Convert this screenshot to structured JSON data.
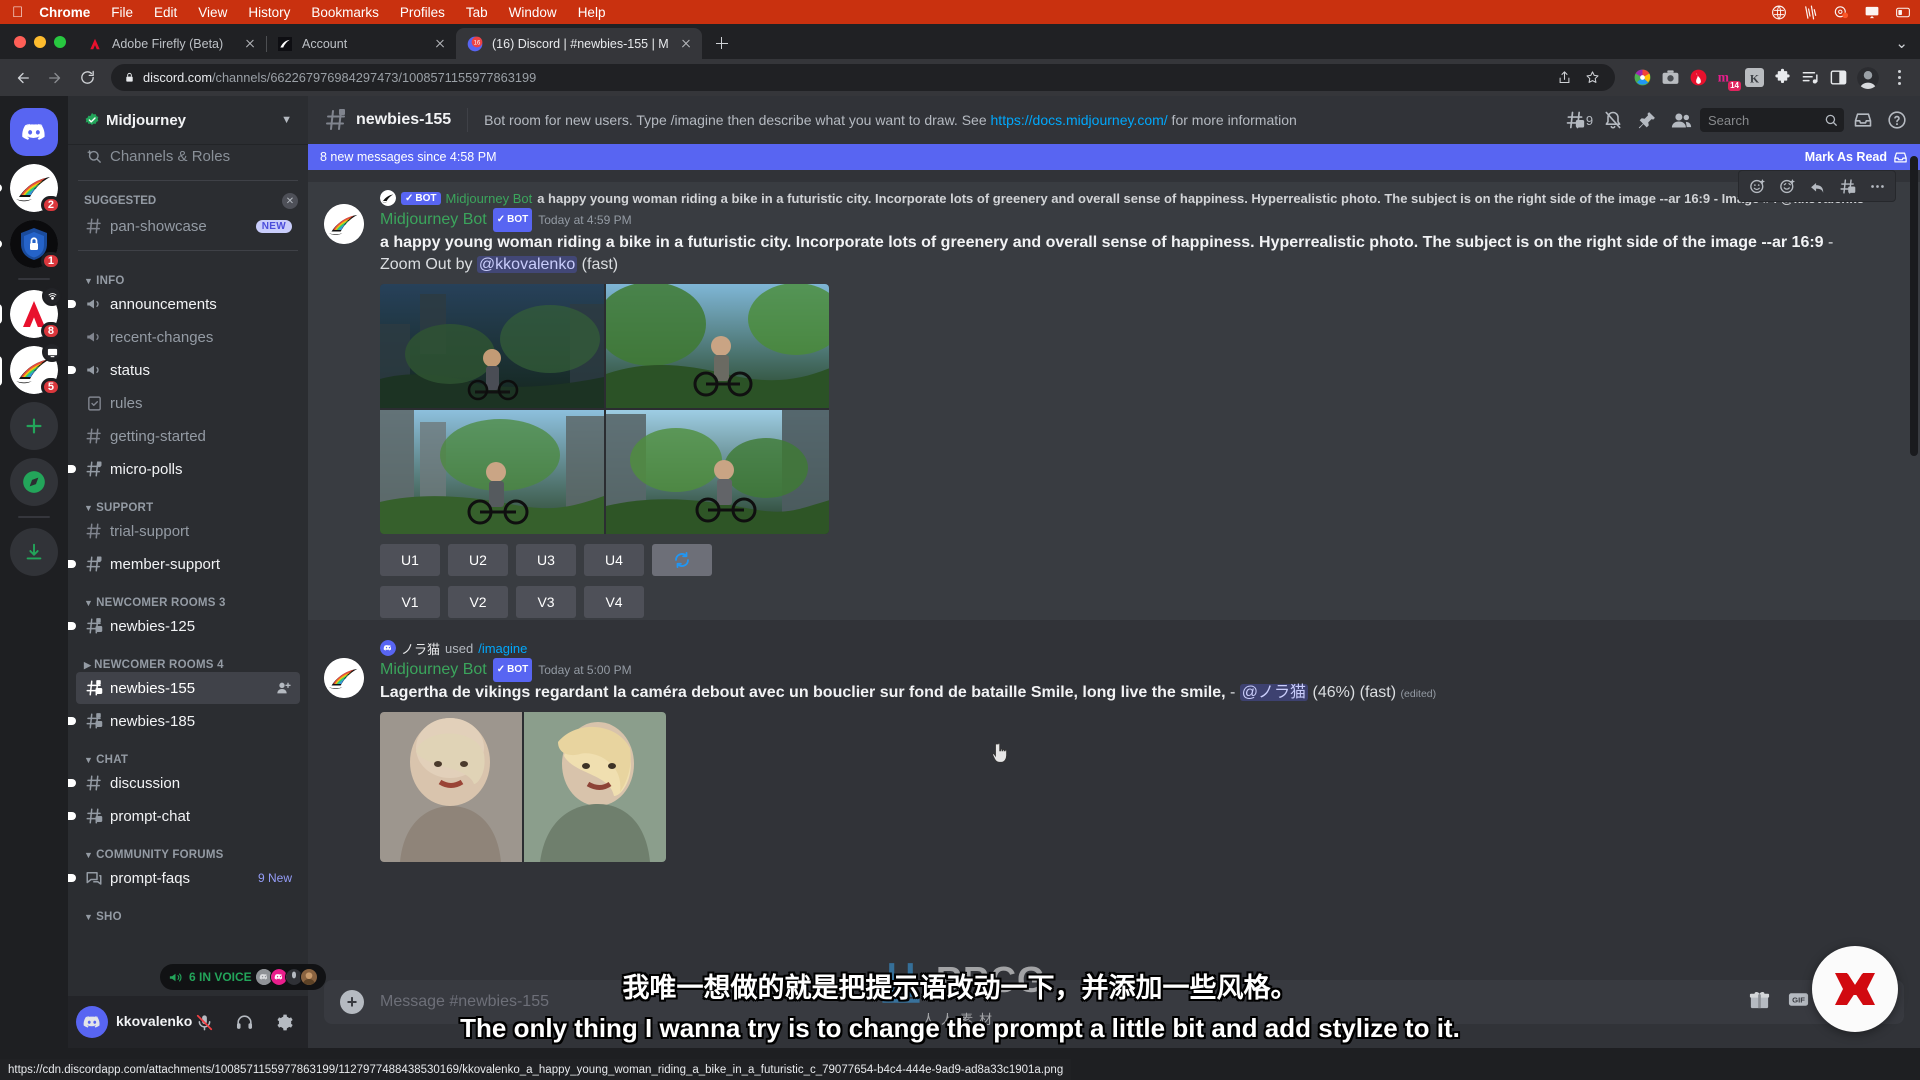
{
  "menubar": {
    "apple": "",
    "items": [
      "Chrome",
      "File",
      "Edit",
      "View",
      "History",
      "Bookmarks",
      "Profiles",
      "Tab",
      "Window",
      "Help"
    ],
    "status_icons": [
      "globe-icon",
      "waveform-icon",
      "color-wheel-icon",
      "airplay-display-icon",
      "control-center-icon"
    ]
  },
  "browser": {
    "tabs": [
      {
        "title": "Adobe Firefly (Beta)",
        "favicon": "adobe-icon",
        "active": false
      },
      {
        "title": "Account",
        "favicon": "midjourney-icon",
        "active": false
      },
      {
        "title": "(16) Discord | #newbies-155 | M",
        "favicon": "discord-badge-16",
        "active": true
      }
    ],
    "new_tab_label": "+",
    "nav": {
      "back": "←",
      "forward": "→",
      "reload": "↻"
    },
    "address": {
      "lock": "lock-icon",
      "host": "discord.com",
      "path": "/channels/662267976984297473/1008571155977863199"
    },
    "omni_actions": [
      "share-icon",
      "bookmark-star-icon"
    ],
    "extensions": [
      {
        "name": "color-palette-extension",
        "badge": ""
      },
      {
        "name": "screenshot-camera-extension",
        "badge": ""
      },
      {
        "name": "record-red-extension",
        "badge": ""
      },
      {
        "name": "mm-pink-extension",
        "badge": "14"
      },
      {
        "name": "gray-k-extension",
        "badge": ""
      },
      {
        "name": "puzzle-extensions-icon",
        "badge": ""
      },
      {
        "name": "playlist-music-icon",
        "badge": ""
      },
      {
        "name": "sidepanel-icon",
        "badge": ""
      }
    ],
    "profile_avatar": "user-avatar",
    "menu": "kebab-menu-icon",
    "window_controls": "maximize-chevron"
  },
  "status_bar": {
    "url": "https://cdn.discordapp.com/attachments/1008571155977863199/1127977488438530169/kkovalenko_a_happy_young_woman_riding_a_bike_in_a_futuristic_c_79077654-b4c4-444e-9ad9-ad8a33c1901a.png"
  },
  "discord": {
    "rail": [
      {
        "name": "home-discord-button",
        "type": "home",
        "badge": ""
      },
      {
        "name": "guild-midjourney-1",
        "type": "sail",
        "badge": "2"
      },
      {
        "name": "guild-shield",
        "type": "shield",
        "badge": "1"
      },
      {
        "name": "guild-adobe",
        "type": "adobe",
        "badge": "8",
        "corner": "stage-icon"
      },
      {
        "name": "guild-midjourney-2",
        "type": "sail",
        "badge": "5",
        "corner": "screenshare-icon"
      },
      {
        "name": "add-server-button",
        "type": "plus",
        "badge": ""
      },
      {
        "name": "explore-servers-button",
        "type": "compass",
        "badge": ""
      },
      {
        "name": "download-apps-button",
        "type": "download",
        "badge": ""
      }
    ],
    "server": {
      "name": "Midjourney",
      "verified": true
    },
    "sidebar": {
      "browse_channels": "Channels & Roles",
      "suggested_header": "SUGGESTED",
      "suggested": [
        {
          "label": "pan-showcase",
          "icon": "hash-icon",
          "badge": "NEW"
        }
      ],
      "groups": [
        {
          "name": "INFO",
          "collapsed": false,
          "channels": [
            {
              "label": "announcements",
              "icon": "announcement-icon",
              "unread": true
            },
            {
              "label": "recent-changes",
              "icon": "announcement-icon",
              "unread": false
            },
            {
              "label": "status",
              "icon": "announcement-icon",
              "unread": true
            },
            {
              "label": "rules",
              "icon": "rules-icon",
              "unread": false
            },
            {
              "label": "getting-started",
              "icon": "hash-icon",
              "unread": false
            },
            {
              "label": "micro-polls",
              "icon": "hash-lock-icon",
              "unread": true
            }
          ]
        },
        {
          "name": "SUPPORT",
          "collapsed": false,
          "channels": [
            {
              "label": "trial-support",
              "icon": "hash-icon",
              "unread": false
            },
            {
              "label": "member-support",
              "icon": "hash-lock-icon",
              "unread": true
            }
          ]
        },
        {
          "name": "NEWCOMER ROOMS 3",
          "collapsed": false,
          "channels": [
            {
              "label": "newbies-125",
              "icon": "hash-thread-icon",
              "unread": true
            }
          ]
        },
        {
          "name": "NEWCOMER ROOMS 4",
          "collapsed": true,
          "channels": [
            {
              "label": "newbies-155",
              "icon": "hash-thread-icon",
              "active": true,
              "trailing": "add-member-icon"
            },
            {
              "label": "newbies-185",
              "icon": "hash-thread-icon",
              "unread": true
            }
          ]
        },
        {
          "name": "CHAT",
          "collapsed": false,
          "channels": [
            {
              "label": "discussion",
              "icon": "hash-icon",
              "unread": true
            },
            {
              "label": "prompt-chat",
              "icon": "hash-thread-icon",
              "unread": true
            }
          ]
        },
        {
          "name": "COMMUNITY FORUMS",
          "collapsed": false,
          "channels": [
            {
              "label": "prompt-faqs",
              "icon": "forum-icon",
              "unread": true,
              "badge": "9 New"
            }
          ]
        },
        {
          "name": "SHO",
          "collapsed": false,
          "channels": []
        }
      ],
      "voice_pill": {
        "label": "6 IN VOICE",
        "icon": "speaker-icon",
        "faces": 4
      }
    },
    "user_panel": {
      "username": "kkovalenko",
      "buttons": [
        "mic-muted-icon",
        "headphones-icon",
        "settings-gear-icon"
      ]
    },
    "topbar": {
      "channel_icon": "hash-thread-lock-icon",
      "channel_name": "newbies-155",
      "topic_before": "Bot room for new users. Type /imagine then describe what you want to draw. See ",
      "topic_link": "https://docs.midjourney.com/",
      "topic_after": " for more information",
      "threads_count": "9",
      "actions": [
        "threads-icon",
        "notifications-muted-icon",
        "pinned-messages-icon",
        "member-list-icon"
      ],
      "search_placeholder": "Search",
      "right_actions": [
        "inbox-icon",
        "help-icon"
      ]
    },
    "new_messages_bar": {
      "text": "8 new messages since 4:58 PM",
      "action": "Mark As Read",
      "icon": "mark-read-icon"
    },
    "messages": [
      {
        "reply": {
          "author": "Midjourney Bot",
          "bot_tag": "BOT",
          "text": "a happy young woman riding a bike in a futuristic city. Incorporate lots of greenery and overall sense of happiness. Hyperrealistic photo. The subject is on the right side of the image --ar 16:9 - Image #4 @kkovalenko"
        },
        "author": "Midjourney Bot",
        "bot_tag": "BOT",
        "timestamp": "Today at 4:59 PM",
        "body_bold": "a happy young woman riding a bike in a futuristic city. Incorporate lots of greenery and overall sense of happiness. Hyperrealistic photo. The subject is on the right side of the image --ar 16:9",
        "body_rest": " - Zoom Out by ",
        "mention": "@kkovalenko",
        "body_tail": " (fast)",
        "grid": "4-image-grid-cyberpunk-cyclist",
        "buttons_row1": [
          "U1",
          "U2",
          "U3",
          "U4"
        ],
        "reroll_button": "reroll-icon",
        "buttons_row2": [
          "V1",
          "V2",
          "V3",
          "V4"
        ],
        "hover_tools": [
          "add-reaction-icon",
          "super-react-icon",
          "reply-icon",
          "create-thread-icon",
          "more-icon"
        ]
      },
      {
        "used_by": "ノラ猫",
        "used_word": "used",
        "command": "/imagine",
        "author": "Midjourney Bot",
        "bot_tag": "BOT",
        "timestamp": "Today at 5:00 PM",
        "body_bold": "Lagertha de vikings regardant la caméra debout avec un bouclier sur fond de bataille Smile, long live the smile,",
        "body_rest": " - ",
        "mention": "@ノラ猫",
        "body_tail": " (46%) (fast) ",
        "edited": "(edited)",
        "grid": "2-image-grid-viking-woman"
      }
    ],
    "composer": {
      "placeholder": "Message #newbies-155",
      "plus": "+",
      "actions": [
        "gift-icon",
        "gif-icon",
        "sticker-icon",
        "emoji-icon"
      ]
    }
  },
  "subtitles": {
    "chinese": "我唯一想做的就是把提示语改动一下，并添加一些风格。",
    "english": "The only thing I wanna try is to change the prompt a little bit and add stylize to it."
  },
  "watermark": {
    "text": "RRCG",
    "sub": "人人素材"
  },
  "colors": {
    "accent_blurple": "#5865f2",
    "discord_bg": "#313338",
    "sidebar_bg": "#2b2d31",
    "rail_bg": "#1e1f22",
    "menubar_red": "#c9310f",
    "online_green": "#23a55a",
    "bot_green": "#3ba55c",
    "link_blue": "#00a8fc",
    "badge_red": "#da373c",
    "corner_logo_red": "#d10a10"
  }
}
